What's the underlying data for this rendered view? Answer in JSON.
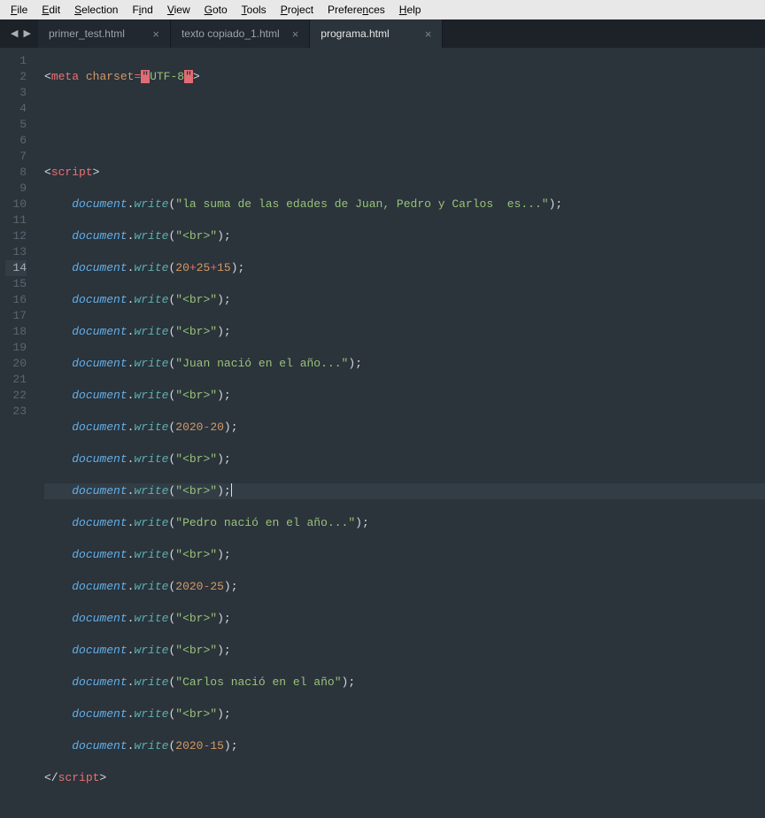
{
  "menu": {
    "file": "File",
    "edit": "Edit",
    "selection": "Selection",
    "find": "Find",
    "view": "View",
    "goto": "Goto",
    "tools": "Tools",
    "project": "Project",
    "preferences": "Preferences",
    "help": "Help"
  },
  "nav": {
    "left": "◀",
    "right": "▶"
  },
  "tabs": [
    {
      "label": "primer_test.html",
      "close": "×",
      "active": false
    },
    {
      "label": "texto copiado_1.html",
      "close": "×",
      "active": false
    },
    {
      "label": "programa.html",
      "close": "×",
      "active": true
    }
  ],
  "gutter": [
    "1",
    "2",
    "3",
    "4",
    "5",
    "6",
    "7",
    "8",
    "9",
    "10",
    "11",
    "12",
    "13",
    "14",
    "15",
    "16",
    "17",
    "18",
    "19",
    "20",
    "21",
    "22",
    "23"
  ],
  "current_line": 14,
  "code": {
    "l1": {
      "meta": "meta",
      "charset": "charset",
      "eq": "=",
      "valq1": "\"",
      "val": "UTF-8",
      "valq2": "\""
    },
    "script_open": "script",
    "script_close": "script",
    "doc": "document",
    "write": "write",
    "s5": "\"la suma de las edades de Juan, Pedro y Carlos  es...\"",
    "sbr": "\"<br>\"",
    "n7a": "20",
    "n7b": "25",
    "n7c": "15",
    "plus": "+",
    "s10": "\"Juan nació en el año...\"",
    "n12a": "2020",
    "n12b": "20",
    "minus": "-",
    "s15": "\"Pedro nació en el año...\"",
    "n17a": "2020",
    "n17b": "25",
    "s20": "\"Carlos nació en el año\"",
    "n22a": "2020",
    "n22b": "15"
  }
}
